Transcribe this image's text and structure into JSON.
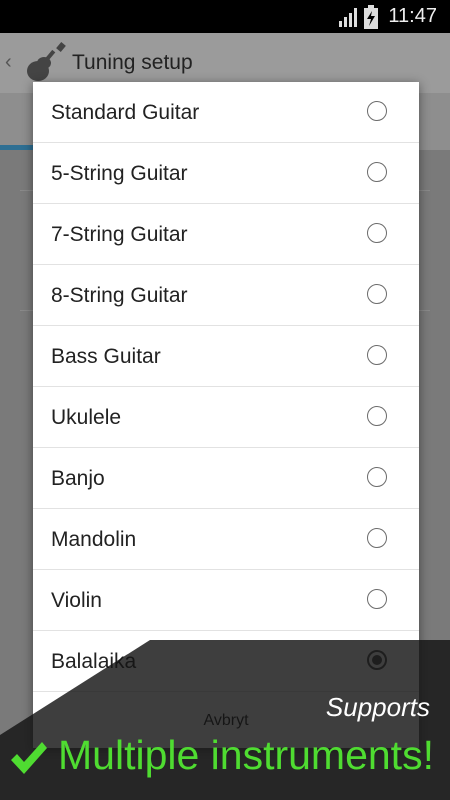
{
  "status_bar": {
    "time": "11:47",
    "icons": [
      "signal-icon",
      "battery-charging-icon"
    ]
  },
  "app_bar": {
    "title": "Tuning setup",
    "icons": [
      "back-chevron-icon",
      "guitar-icon"
    ]
  },
  "dialog": {
    "options": [
      {
        "label": "Standard Guitar",
        "selected": false
      },
      {
        "label": "5-String Guitar",
        "selected": false
      },
      {
        "label": "7-String Guitar",
        "selected": false
      },
      {
        "label": "8-String Guitar",
        "selected": false
      },
      {
        "label": "Bass Guitar",
        "selected": false
      },
      {
        "label": "Ukulele",
        "selected": false
      },
      {
        "label": "Banjo",
        "selected": false
      },
      {
        "label": "Mandolin",
        "selected": false
      },
      {
        "label": "Violin",
        "selected": false
      },
      {
        "label": "Balalaika",
        "selected": true
      }
    ],
    "cancel_label": "Avbryt"
  },
  "promo": {
    "subtitle": "Supports",
    "headline": "Multiple instruments!",
    "accent_color": "#4fdc31"
  }
}
